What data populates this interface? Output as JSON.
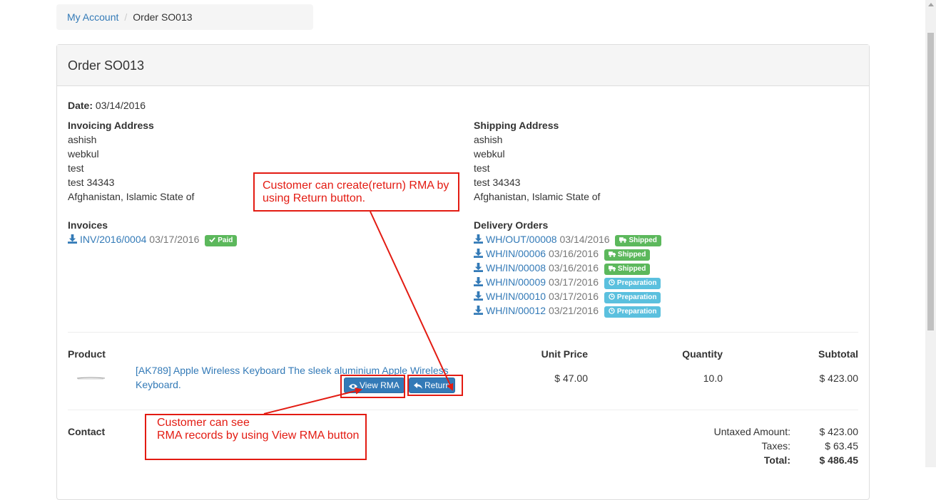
{
  "breadcrumb": {
    "home": "My Account",
    "current": "Order SO013"
  },
  "order": {
    "title": "Order SO013",
    "date_label": "Date:",
    "date_value": "03/14/2016",
    "invoicing": {
      "heading": "Invoicing Address",
      "lines": [
        "ashish",
        "webkul",
        "test",
        "test 34343",
        "Afghanistan, Islamic State of"
      ]
    },
    "shipping": {
      "heading": "Shipping Address",
      "lines": [
        "ashish",
        "webkul",
        "test",
        "test 34343",
        "Afghanistan, Islamic State of"
      ]
    },
    "invoices": {
      "heading": "Invoices",
      "items": [
        {
          "ref": "INV/2016/0004",
          "date": "03/17/2016",
          "status": "Paid"
        }
      ]
    },
    "deliveries": {
      "heading": "Delivery Orders",
      "items": [
        {
          "ref": "WH/OUT/00008",
          "date": "03/14/2016",
          "status": "Shipped"
        },
        {
          "ref": "WH/IN/00006",
          "date": "03/16/2016",
          "status": "Shipped"
        },
        {
          "ref": "WH/IN/00008",
          "date": "03/16/2016",
          "status": "Shipped"
        },
        {
          "ref": "WH/IN/00009",
          "date": "03/17/2016",
          "status": "Preparation"
        },
        {
          "ref": "WH/IN/00010",
          "date": "03/17/2016",
          "status": "Preparation"
        },
        {
          "ref": "WH/IN/00012",
          "date": "03/21/2016",
          "status": "Preparation"
        }
      ]
    },
    "table": {
      "headers": {
        "product": "Product",
        "unit_price": "Unit Price",
        "quantity": "Quantity",
        "subtotal": "Subtotal"
      },
      "rows": [
        {
          "name_line1": "[AK789] Apple Wireless Keyboard The sleek aluminium Apple Wireless",
          "name_line2": "Keyboard.",
          "unit_price": "$ 47.00",
          "quantity": "10.0",
          "subtotal": "$ 423.00",
          "view_rma_label": "View RMA",
          "return_label": "Return"
        }
      ]
    },
    "contact_heading": "Contact",
    "totals": {
      "untaxed_label": "Untaxed Amount:",
      "untaxed_value": "$ 423.00",
      "taxes_label": "Taxes:",
      "taxes_value": "$ 63.45",
      "total_label": "Total:",
      "total_value": "$ 486.45"
    }
  },
  "annotations": {
    "return_note": [
      "Customer can create(return) RMA by",
      "using Return button."
    ],
    "view_rma_note": [
      "Customer can see",
      "RMA records by using View RMA button"
    ]
  },
  "colors": {
    "link": "#337ab7",
    "success": "#5cb85c",
    "info": "#5bc0de",
    "annotation": "#e31b12"
  }
}
